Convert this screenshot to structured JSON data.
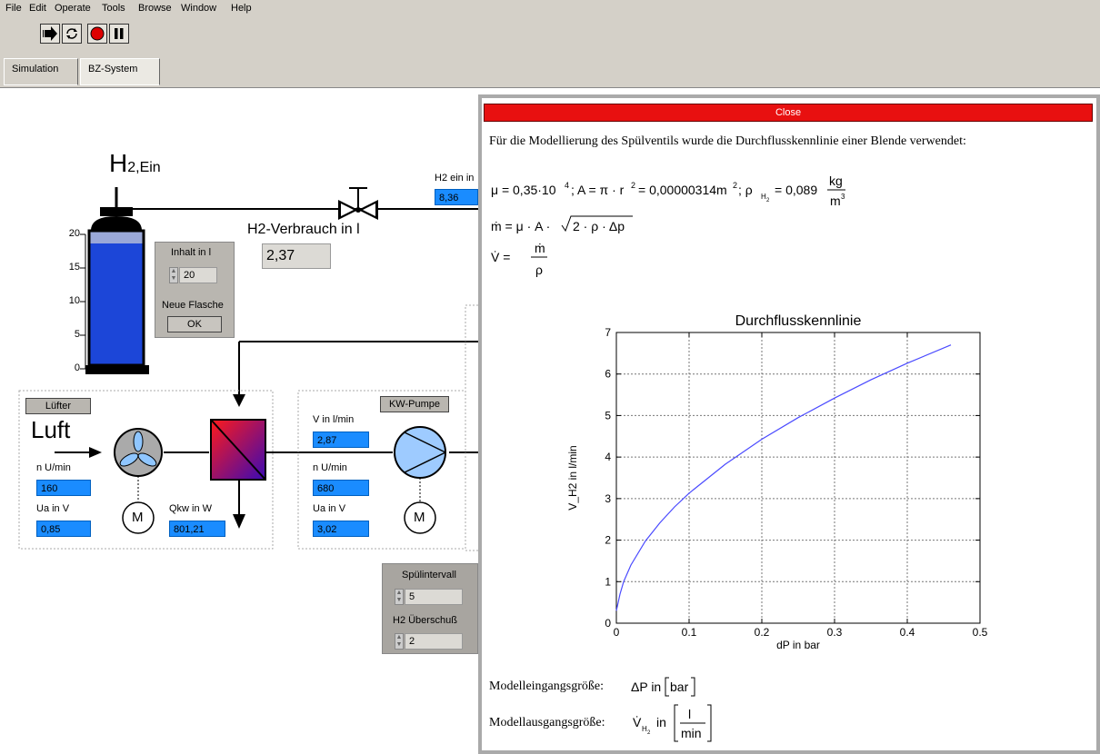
{
  "menu": [
    "File",
    "Edit",
    "Operate",
    "Tools",
    "Browse",
    "Window",
    "Help"
  ],
  "tabs": {
    "simulation": "Simulation",
    "bz_system": "BZ-System"
  },
  "diagram": {
    "h2_title_main": "H",
    "h2_title_sub": "2,Ein",
    "tank_ticks": [
      "20",
      "15",
      "10",
      "5",
      "0"
    ],
    "tank_level": 0.8,
    "inhalt_label": "Inhalt in l",
    "inhalt_value": "20",
    "neue_flasche_label": "Neue Flasche",
    "ok_label": "OK",
    "verbrauch_label": "H2-Verbrauch in l",
    "verbrauch_value": "2,37",
    "h2_ein_label": "H2 ein in",
    "h2_ein_value": "8,36",
    "luefter_label": "Lüfter",
    "luft_label": "Luft",
    "n_label_1": "n U/min",
    "n_value_1": "160",
    "ua_label_1": "Ua in V",
    "ua_value_1": "0,85",
    "qkw_label": "Qkw in W",
    "qkw_value": "801,21",
    "v_label": "V in l/min",
    "v_value": "2,87",
    "n_label_2": "n U/min",
    "n_value_2": "680",
    "ua_label_2": "Ua in V",
    "ua_value_2": "3,02",
    "kw_pumpe_label": "KW-Pumpe",
    "motor_label": "M",
    "spuel_label": "Spülintervall",
    "spuel_value": "5",
    "ueberschuss_label": "H2 Überschuß",
    "ueberschuss_value": "2"
  },
  "dialog": {
    "close_label": "Close",
    "intro": "Für die Modellierung des Spülventils wurde die Durchflusskennlinie einer Blende verwendet:",
    "eingang_label": "Modelleingangsgröße:",
    "ausgang_label": "Modellausgangsgröße:"
  },
  "chart_data": {
    "type": "line",
    "title": "Durchflusskennlinie",
    "xlabel": "dP in bar",
    "ylabel": "V_H2 in l/min",
    "xlim": [
      0,
      0.5
    ],
    "ylim": [
      0,
      7
    ],
    "xticks": [
      "0",
      "0.1",
      "0.2",
      "0.3",
      "0.4",
      "0.5"
    ],
    "yticks": [
      "0",
      "1",
      "2",
      "3",
      "4",
      "5",
      "6",
      "7"
    ],
    "grid": true,
    "series": [
      {
        "color": "#4a4aff",
        "x": [
          0.0,
          0.005,
          0.01,
          0.02,
          0.04,
          0.06,
          0.08,
          0.1,
          0.15,
          0.2,
          0.25,
          0.3,
          0.35,
          0.4,
          0.46
        ],
        "y": [
          0.3,
          0.7,
          1.0,
          1.4,
          1.98,
          2.42,
          2.8,
          3.13,
          3.83,
          4.43,
          4.95,
          5.42,
          5.86,
          6.26,
          6.7
        ]
      }
    ]
  }
}
